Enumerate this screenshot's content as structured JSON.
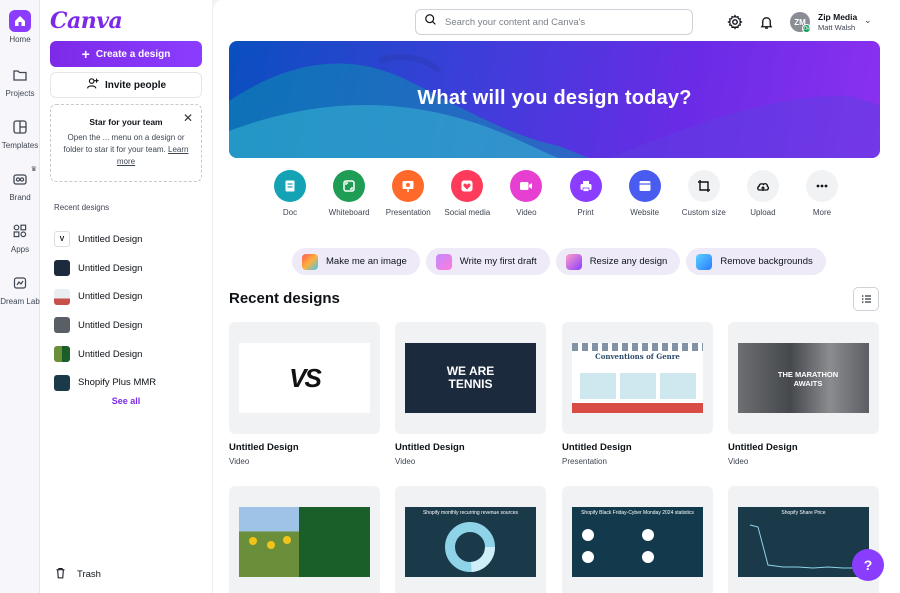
{
  "rail": [
    {
      "label": "Home",
      "icon": "home-icon"
    },
    {
      "label": "Projects",
      "icon": "folder-icon"
    },
    {
      "label": "Templates",
      "icon": "templates-icon"
    },
    {
      "label": "Brand",
      "icon": "brand-icon"
    },
    {
      "label": "Apps",
      "icon": "apps-icon"
    },
    {
      "label": "Dream Lab",
      "icon": "dream-lab-icon"
    }
  ],
  "panel": {
    "logo": "Canva",
    "create_label": "Create a design",
    "invite_label": "Invite people",
    "star_title": "Star for your team",
    "star_text": "Open the ... menu on a design or folder to star it for your team.",
    "star_link": "Learn more",
    "recent_heading": "Recent designs",
    "recent_items": [
      "Untitled Design",
      "Untitled Design",
      "Untitled Design",
      "Untitled Design",
      "Untitled Design",
      "Shopify Plus MMR"
    ],
    "see_all": "See all",
    "trash": "Trash"
  },
  "header": {
    "search_placeholder": "Search your content and Canva's",
    "avatar_initials": "ZM",
    "avatar_badge": "ZM",
    "account_name": "Zip Media",
    "account_user": "Matt Walsh"
  },
  "hero": {
    "title": "What will you design today?"
  },
  "design_types": [
    {
      "label": "Doc",
      "color": "#13a3b5"
    },
    {
      "label": "Whiteboard",
      "color": "#1f9d55"
    },
    {
      "label": "Presentation",
      "color": "#ff6a2b"
    },
    {
      "label": "Social media",
      "color": "#ff3b5c"
    },
    {
      "label": "Video",
      "color": "#e83fd3"
    },
    {
      "label": "Print",
      "color": "#8b3dff"
    },
    {
      "label": "Website",
      "color": "#4a5cf0"
    },
    {
      "label": "Custom size",
      "color": "#f1f2f4"
    },
    {
      "label": "Upload",
      "color": "#f1f2f4"
    },
    {
      "label": "More",
      "color": "#f1f2f4"
    }
  ],
  "chips": [
    "Make me an image",
    "Write my first draft",
    "Resize any design",
    "Remove backgrounds"
  ],
  "recent": {
    "title": "Recent designs",
    "cards": [
      {
        "title": "Untitled Design",
        "type": "Video",
        "art_text": "VS"
      },
      {
        "title": "Untitled Design",
        "type": "Video",
        "art_text": "WE ARE TENNIS"
      },
      {
        "title": "Untitled Design",
        "type": "Presentation",
        "art_text": "Conventions of Genre"
      },
      {
        "title": "Untitled Design",
        "type": "Video",
        "art_text": "THE MARATHON AWAITS"
      },
      {
        "title": "",
        "type": "",
        "art_text": ""
      },
      {
        "title": "",
        "type": "",
        "art_text": "Shopify monthly recurring revenue sources"
      },
      {
        "title": "",
        "type": "",
        "art_text": "Shopify Black Friday-Cyber Monday 2024 statistics"
      },
      {
        "title": "",
        "type": "",
        "art_text": "Shopify Share Price"
      }
    ]
  },
  "help_label": "?"
}
